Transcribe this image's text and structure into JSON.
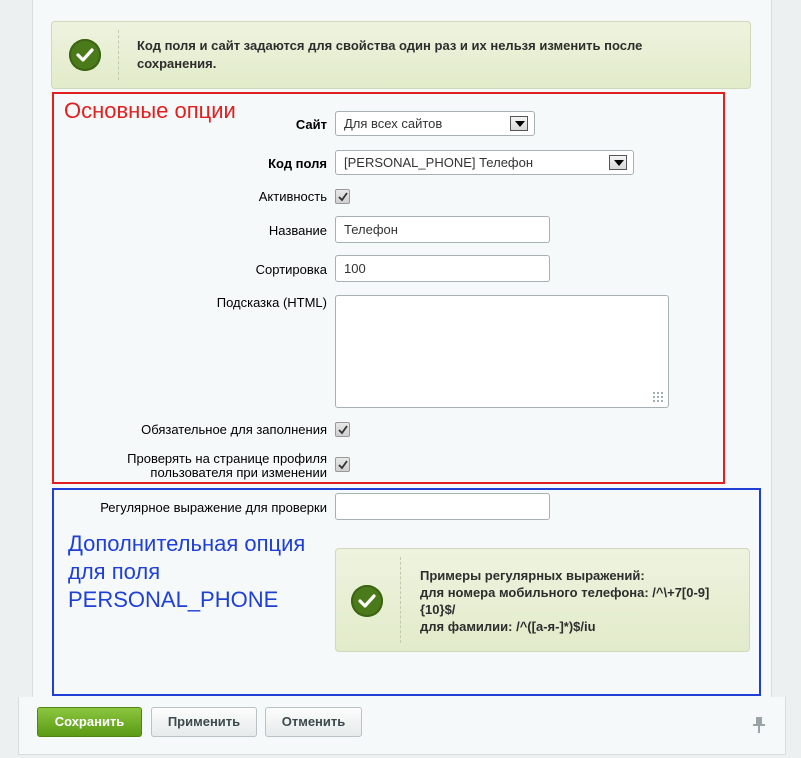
{
  "info": {
    "text_line1": "Код поля и сайт задаются для свойства один раз и их нельзя изменить после",
    "text_line2": "сохранения."
  },
  "annotations": {
    "main_options": "Основные опции",
    "extra_option_line1": "Дополнительная опция",
    "extra_option_line2": "для поля",
    "extra_option_line3": "PERSONAL_PHONE",
    "main_color": "#e02020",
    "extra_color": "#1f3fd6"
  },
  "form": {
    "site": {
      "label": "Сайт",
      "value": "Для всех сайтов"
    },
    "field_code": {
      "label": "Код поля",
      "value": "[PERSONAL_PHONE] Телефон"
    },
    "active": {
      "label": "Активность",
      "checked": true
    },
    "name": {
      "label": "Название",
      "value": "Телефон"
    },
    "sort": {
      "label": "Сортировка",
      "value": "100"
    },
    "hint": {
      "label": "Подсказка (HTML)",
      "value": ""
    },
    "required": {
      "label": "Обязательное для заполнения",
      "checked": true
    },
    "check_profile": {
      "label_line1": "Проверять на странице профиля",
      "label_line2": "пользователя при изменении",
      "checked": true
    },
    "regex": {
      "label": "Регулярное выражение для проверки",
      "value": ""
    }
  },
  "help": {
    "line1": "Примеры регулярных выражений:",
    "line2": "для номера мобильного телефона: /^\\+7[0-9]",
    "line3": "{10}$/",
    "line4": "для фамилии: /^([а-я-]*)$/iu"
  },
  "buttons": {
    "save": "Сохранить",
    "apply": "Применить",
    "cancel": "Отменить"
  },
  "icons": {
    "info_check": "check-circle-icon",
    "pin": "pin-icon"
  },
  "colors": {
    "save_button": "#6aad21",
    "info_box_bg": "#e8efd5"
  }
}
